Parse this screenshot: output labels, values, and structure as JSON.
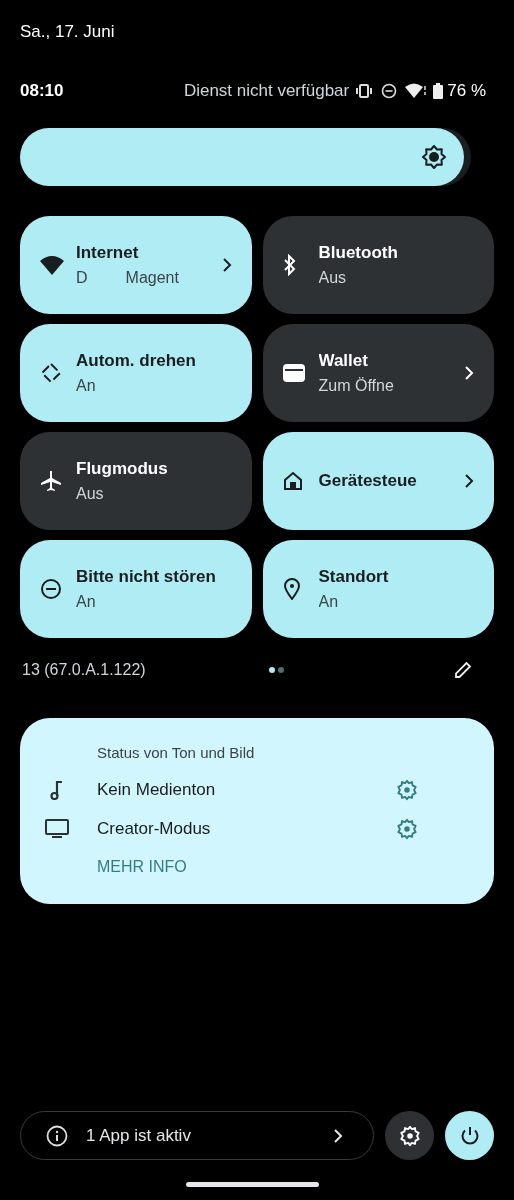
{
  "header": {
    "date": "Sa., 17. Juni"
  },
  "status_bar": {
    "time": "08:10",
    "carrier": "Dienst nicht verfügbar",
    "battery": "76 %"
  },
  "brightness": {
    "level": 0.985
  },
  "tiles": [
    {
      "label": "Internet",
      "subtitles": [
        "D",
        "Magent"
      ],
      "on": true,
      "chevron": true
    },
    {
      "label": "Bluetooth",
      "subtitles": [
        "Aus"
      ],
      "on": false,
      "chevron": false
    },
    {
      "label": "Autom. drehen",
      "subtitles": [
        "An"
      ],
      "on": true,
      "chevron": false
    },
    {
      "label": "Wallet",
      "subtitles": [
        "Zum Öffne"
      ],
      "on": false,
      "chevron": true
    },
    {
      "label": "Flugmodus",
      "subtitles": [
        "Aus"
      ],
      "on": false,
      "chevron": false
    },
    {
      "label": "Gerätesteue",
      "on": true,
      "chevron": true
    },
    {
      "label": "Bitte nicht stören",
      "subtitles": [
        "An"
      ],
      "on": true,
      "chevron": false
    },
    {
      "label": "Standort",
      "subtitles": [
        "An"
      ],
      "on": true,
      "chevron": false
    }
  ],
  "build": "13 (67.0.A.1.122)",
  "pages": [
    {
      "selected": true
    },
    {
      "selected": false
    }
  ],
  "media_card": {
    "title": "Status von Ton und Bild",
    "items": [
      {
        "label": "Kein Medienton"
      },
      {
        "label": "Creator-Modus"
      }
    ],
    "link": "MEHR INFO"
  },
  "footer": {
    "active_apps": "1 App ist aktiv"
  }
}
